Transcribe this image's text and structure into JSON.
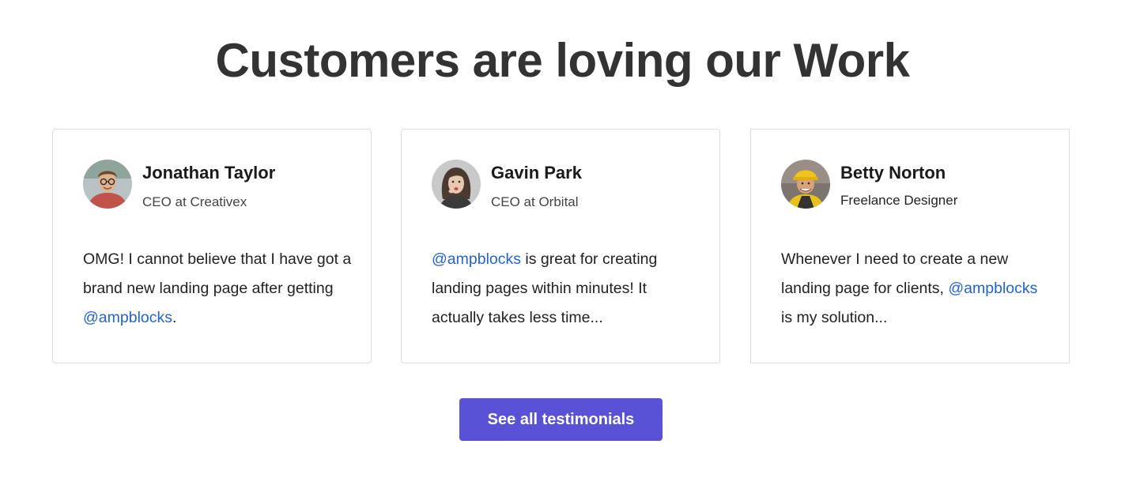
{
  "heading": "Customers are loving our Work",
  "colors": {
    "heading": "#333333",
    "mention": "#2563cc",
    "cta_bg": "#5952d6",
    "card_border": "#dddddd"
  },
  "testimonials": [
    {
      "name": "Jonathan Taylor",
      "role": "CEO at Creativex",
      "avatar_icon": "man-with-glasses-avatar",
      "quote_before": "OMG! I cannot believe that I have got a brand new landing page after getting ",
      "mention": "@ampblocks",
      "quote_after": "."
    },
    {
      "name": "Gavin Park",
      "role": "CEO at Orbital",
      "avatar_icon": "woman-avatar",
      "quote_before": "",
      "mention": "@ampblocks",
      "quote_after": " is great for creating landing pages within minutes! It actually takes less time..."
    },
    {
      "name": "Betty Norton",
      "role": "Freelance Designer",
      "avatar_icon": "construction-worker-avatar",
      "quote_before": "Whenever I need to create a new landing page for clients, ",
      "mention": "@ampblocks",
      "quote_after": " is my solution..."
    }
  ],
  "cta": {
    "label": "See all testimonials"
  }
}
